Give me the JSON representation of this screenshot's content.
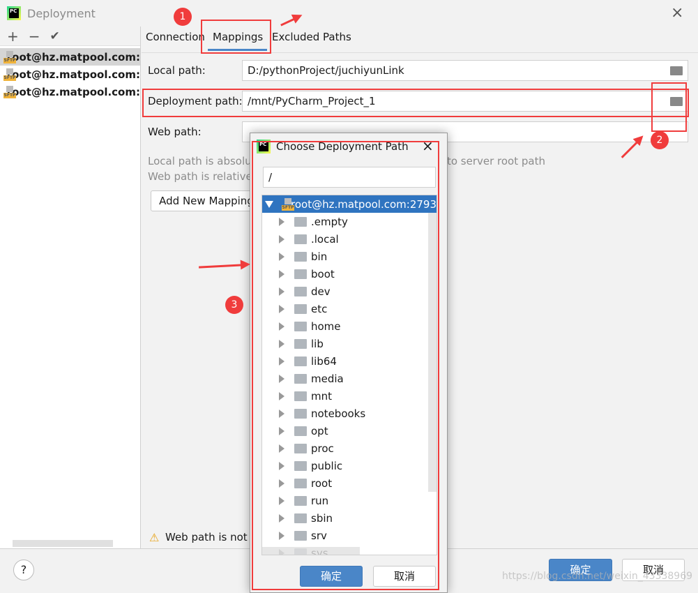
{
  "window": {
    "title": "Deployment",
    "close": "×"
  },
  "toolbar": {
    "add": "+",
    "remove": "−",
    "check": "✔"
  },
  "servers": [
    {
      "name": "root@hz.matpool.com:"
    },
    {
      "name": "root@hz.matpool.com:"
    },
    {
      "name": "root@hz.matpool.com:"
    }
  ],
  "tabs": [
    {
      "label": "Connection"
    },
    {
      "label": "Mappings",
      "active": true
    },
    {
      "label": "Excluded Paths"
    }
  ],
  "mappings": {
    "local_label": "Local path:",
    "local_value": "D:/pythonProject/juchiyunLink",
    "deploy_label": "Deployment path:",
    "deploy_value": "/mnt/PyCharm_Project_1",
    "web_label": "Web path:",
    "web_value": "",
    "hint1": "Local path is absolute, deployment path is relative to server root path (/).",
    "hint2": "Web path is relative",
    "add_mapping": "Add New Mapping",
    "warning": "Web path is not s"
  },
  "footer": {
    "help": "?",
    "ok": "确定",
    "cancel": "取消"
  },
  "chooser": {
    "title": "Choose Deployment Path",
    "close": "×",
    "path_value": "/",
    "root": "root@hz.matpool.com:2793",
    "folders": [
      ".empty",
      ".local",
      "bin",
      "boot",
      "dev",
      "etc",
      "home",
      "lib",
      "lib64",
      "media",
      "mnt",
      "notebooks",
      "opt",
      "proc",
      "public",
      "root",
      "run",
      "sbin",
      "srv",
      "sys"
    ],
    "ok": "确定",
    "cancel": "取消"
  },
  "annotations": {
    "b1": "1",
    "b2": "2",
    "b3": "3",
    "color": "#f03c3c"
  },
  "watermark": "https://blog.csdn.net/weixin_43338969",
  "colors": {
    "accent": "#2f74c0",
    "primary_button": "#4a86c8"
  }
}
